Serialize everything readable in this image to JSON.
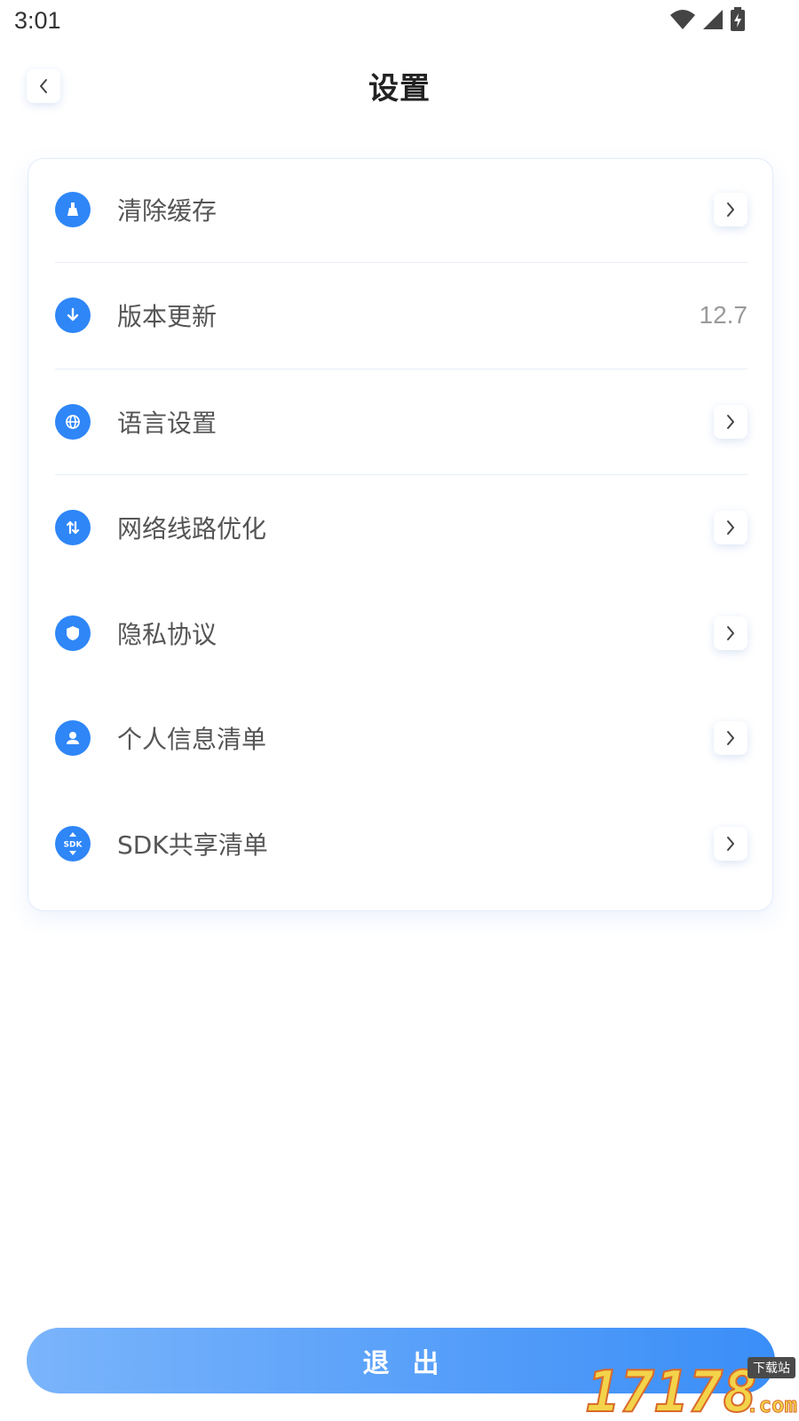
{
  "status_bar": {
    "time": "3:01",
    "icons": [
      "wifi-icon",
      "cellular-signal-icon",
      "battery-charging-icon"
    ]
  },
  "header": {
    "title": "设置",
    "back_icon": "chevron-left-icon"
  },
  "settings": {
    "items": [
      {
        "key": "clear-cache",
        "label": "清除缓存",
        "icon": "broom-icon",
        "value": ""
      },
      {
        "key": "version-update",
        "label": "版本更新",
        "icon": "download-arrow-icon",
        "value": "12.7"
      },
      {
        "key": "language-settings",
        "label": "语言设置",
        "icon": "globe-icon",
        "value": ""
      },
      {
        "key": "network-route-optimize",
        "label": "网络线路优化",
        "icon": "swap-vertical-icon",
        "value": ""
      },
      {
        "key": "privacy-policy",
        "label": "隐私协议",
        "icon": "shield-icon",
        "value": ""
      },
      {
        "key": "personal-info-list",
        "label": "个人信息清单",
        "icon": "person-icon",
        "value": ""
      },
      {
        "key": "sdk-share-list",
        "label": "SDK共享清单",
        "icon": "sdk-icon",
        "value": ""
      }
    ]
  },
  "logout": {
    "label": "退出"
  },
  "watermark": {
    "number": "17178",
    "tag": "下载站",
    "suffix": ".com"
  },
  "colors": {
    "accent": "#2e86f7",
    "button_gradient_start": "#7ab4fb",
    "button_gradient_end": "#3a8ef8",
    "card_border": "#e2ebfb"
  }
}
